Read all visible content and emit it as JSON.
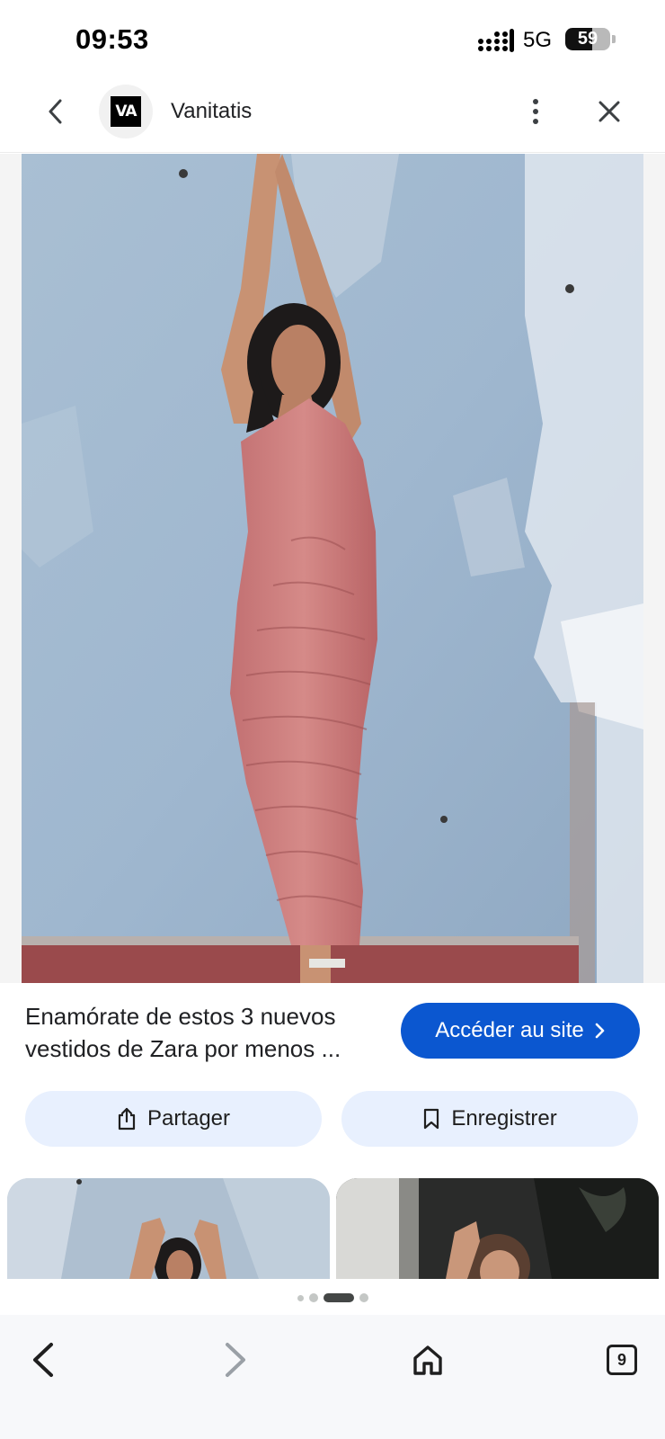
{
  "status_bar": {
    "time": "09:53",
    "network": "5G",
    "battery_percent": "59",
    "battery_level": 0.59
  },
  "header": {
    "site_name": "Vanitatis",
    "logo_text": "VA",
    "icons": {
      "back": "chevron-left-icon",
      "more": "more-vertical-icon",
      "close": "close-icon"
    }
  },
  "main_image": {
    "alt_icon": "photo-image"
  },
  "result": {
    "caption_line1": "Enamórate de estos 3 nuevos",
    "caption_line2": "vestidos de Zara por menos ...",
    "visit_label": "Accéder au site",
    "visit_color": "#0b57d0"
  },
  "actions": {
    "share_label": "Partager",
    "save_label": "Enregistrer",
    "button_bg": "#e8f0fe"
  },
  "pagination": {
    "dot_count": 4,
    "active_index": 2
  },
  "bottom_nav": {
    "tabs_count": "9"
  }
}
